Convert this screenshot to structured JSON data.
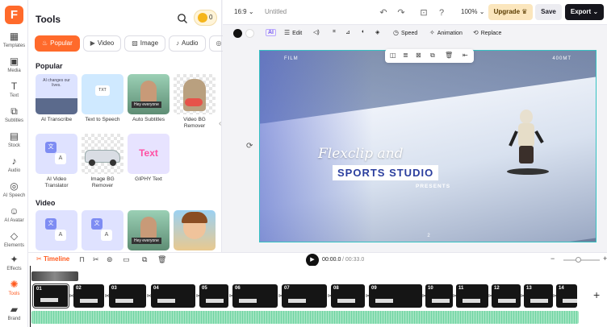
{
  "rail": {
    "logo": "F",
    "items": [
      {
        "label": "Templates",
        "icon": "templates-icon"
      },
      {
        "label": "Media",
        "icon": "media-icon"
      },
      {
        "label": "Text",
        "icon": "text-icon"
      },
      {
        "label": "Subtitles",
        "icon": "subtitles-icon"
      },
      {
        "label": "Stock",
        "icon": "stock-icon"
      },
      {
        "label": "Audio",
        "icon": "audio-icon"
      },
      {
        "label": "AI Speech",
        "icon": "ai-speech-icon"
      },
      {
        "label": "AI Avatar",
        "icon": "ai-avatar-icon"
      },
      {
        "label": "Elements",
        "icon": "elements-icon"
      },
      {
        "label": "Effects",
        "icon": "effects-icon"
      },
      {
        "label": "Tools",
        "icon": "tools-icon"
      },
      {
        "label": "Brand",
        "icon": "brand-icon"
      }
    ]
  },
  "panel": {
    "title": "Tools",
    "coins": "0",
    "tabs": [
      {
        "label": "Popular",
        "icon": "fire-icon"
      },
      {
        "label": "Video",
        "icon": "video-icon"
      },
      {
        "label": "Image",
        "icon": "image-icon"
      },
      {
        "label": "Audio",
        "icon": "audio-icon"
      },
      {
        "label": "C",
        "icon": "other-icon"
      }
    ],
    "popular_head": "Popular",
    "popular": [
      {
        "label": "AI Transcribe",
        "thumb_text": "AI changes our lives."
      },
      {
        "label": "Text to Speech",
        "thumb_text": "TXT"
      },
      {
        "label": "Auto Subtitles",
        "thumb_text": "Hey everyone"
      },
      {
        "label": "Video BG Remover",
        "thumb_text": ""
      },
      {
        "label": "AI Video Translator",
        "thumb_text": ""
      },
      {
        "label": "Image BG Remover",
        "thumb_text": ""
      },
      {
        "label": "GIPHY Text",
        "thumb_text": "Text"
      }
    ],
    "video_head": "Video",
    "video_thumbs": [
      {
        "thumb_text": ""
      },
      {
        "thumb_text": ""
      },
      {
        "thumb_text": "Hey everyone"
      },
      {
        "thumb_text": ""
      }
    ]
  },
  "topbar": {
    "ratio": "16:9",
    "title": "Untitled",
    "zoom": "100%",
    "upgrade": "Upgrade",
    "save": "Save",
    "export": "Export"
  },
  "toolbar": {
    "edit": "Edit",
    "speed": "Speed",
    "animation": "Animation",
    "replace": "Replace",
    "ai": "AI"
  },
  "canvas": {
    "film_left": "FILM",
    "film_right": "400MT",
    "script_title": "Flexclip and",
    "main_title": "SPORTS STUDIO",
    "sub_title": "PRESENTS",
    "bottom_num": "2"
  },
  "timeline": {
    "label": "Timeline",
    "current": "00:00.0",
    "total": "/ 00:33.0",
    "clips": [
      "01",
      "02",
      "03",
      "04",
      "05",
      "06",
      "07",
      "08",
      "09",
      "10",
      "11",
      "12",
      "13",
      "14"
    ]
  }
}
